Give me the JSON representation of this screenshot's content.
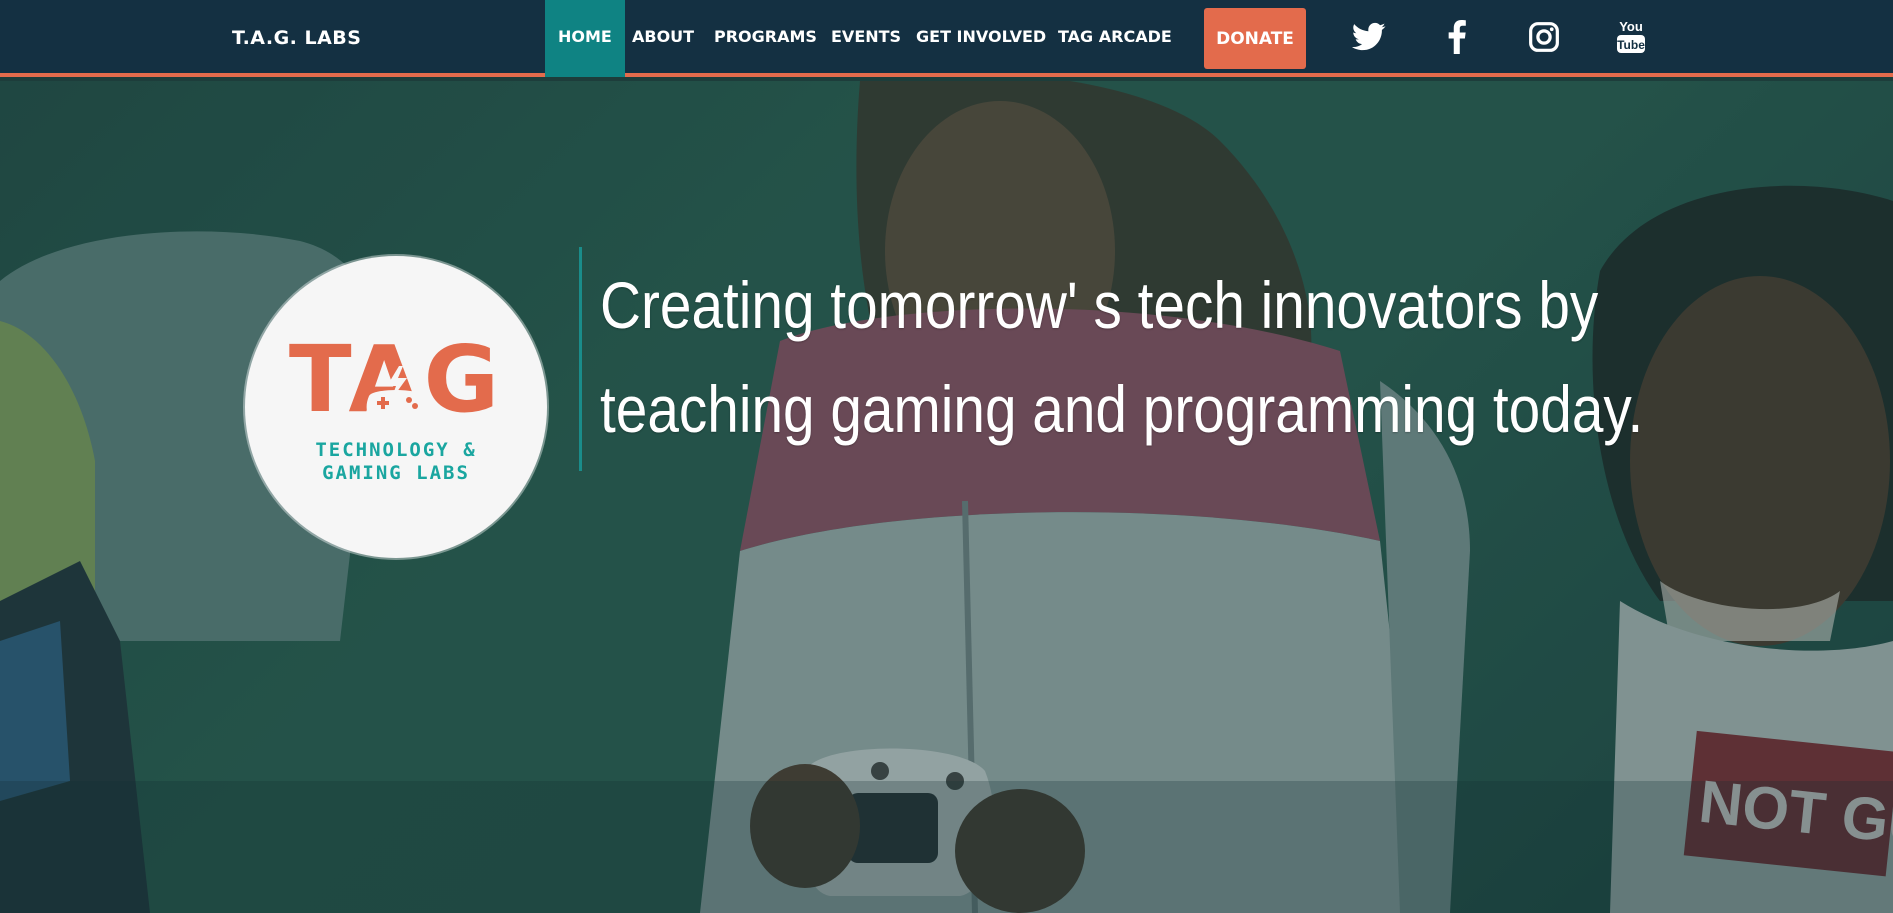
{
  "brand": "T.A.G. LABS",
  "nav": {
    "items": [
      {
        "label": "HOME",
        "active": true
      },
      {
        "label": "ABOUT",
        "active": false
      },
      {
        "label": "PROGRAMS",
        "active": false
      },
      {
        "label": "EVENTS",
        "active": false
      },
      {
        "label": "GET INVOLVED",
        "active": false
      },
      {
        "label": "TAG ARCADE",
        "active": false
      }
    ],
    "donate_label": "DONATE"
  },
  "social": [
    {
      "icon": "twitter-icon"
    },
    {
      "icon": "facebook-icon"
    },
    {
      "icon": "instagram-icon"
    },
    {
      "icon": "youtube-icon",
      "text_top": "You",
      "text_bottom": "Tube"
    }
  ],
  "hero": {
    "logo": {
      "letters": "TAG",
      "subtitle_line1": "TECHNOLOGY &",
      "subtitle_line2": "GAMING LABS"
    },
    "tagline_line1": "Creating tomorrow' s tech innovators by",
    "tagline_line2": "teaching gaming and programming today.",
    "shirt_text": "NOT GUILT"
  },
  "colors": {
    "nav_bg": "#143042",
    "accent": "#e36b4c",
    "active_tab": "#0f8383",
    "logo_teal": "#1aa6a0"
  }
}
